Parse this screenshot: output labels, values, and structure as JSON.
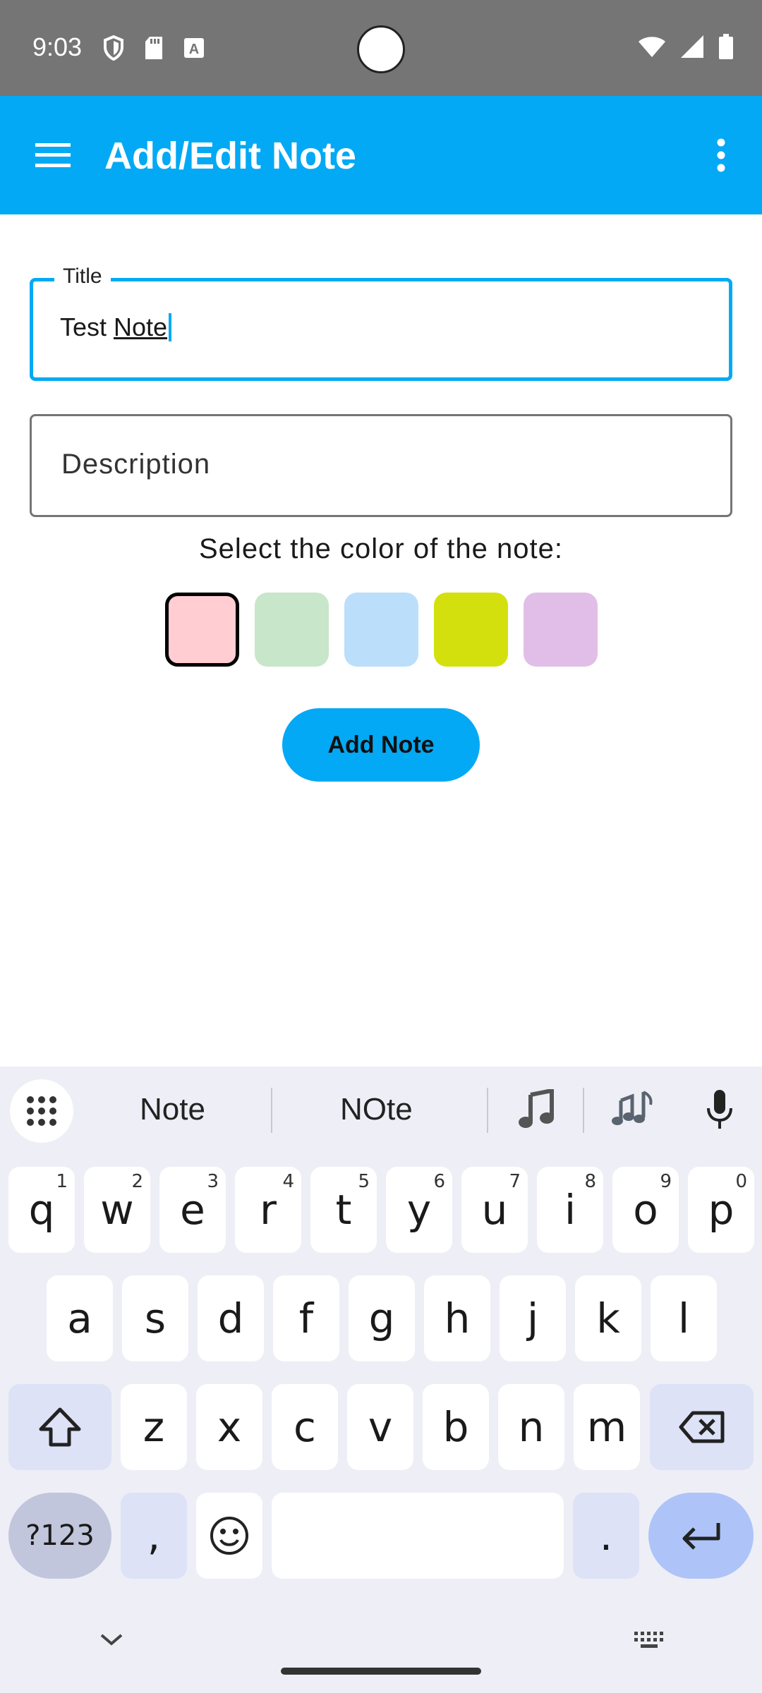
{
  "status_bar": {
    "time": "9:03",
    "icons_left": [
      "shield-icon",
      "sd-card-icon",
      "font-a-icon"
    ],
    "icons_right": [
      "wifi-icon",
      "signal-icon",
      "battery-icon"
    ]
  },
  "app_bar": {
    "title": "Add/Edit Note",
    "background": "#03a9f4",
    "menu_icon": "hamburger-menu-icon",
    "overflow_icon": "more-vert-icon"
  },
  "form": {
    "title_field": {
      "label": "Title",
      "value_plain": "Test ",
      "value_composing": "Note"
    },
    "description_field": {
      "placeholder": "Description"
    },
    "color_prompt": "Select the color of the note:",
    "colors": [
      {
        "name": "pink",
        "hex": "#ffcdd2",
        "selected": true
      },
      {
        "name": "green",
        "hex": "#c8e6c9",
        "selected": false
      },
      {
        "name": "blue",
        "hex": "#bbdefb",
        "selected": false
      },
      {
        "name": "lime",
        "hex": "#d4e00e",
        "selected": false
      },
      {
        "name": "purple",
        "hex": "#e1bee7",
        "selected": false
      }
    ],
    "submit_label": "Add Note"
  },
  "keyboard": {
    "suggestions": [
      "Note",
      "NOte"
    ],
    "emoji_suggestions": [
      "musical-note-emoji",
      "musical-notes-emoji"
    ],
    "row1": [
      {
        "k": "q",
        "h": "1"
      },
      {
        "k": "w",
        "h": "2"
      },
      {
        "k": "e",
        "h": "3"
      },
      {
        "k": "r",
        "h": "4"
      },
      {
        "k": "t",
        "h": "5"
      },
      {
        "k": "y",
        "h": "6"
      },
      {
        "k": "u",
        "h": "7"
      },
      {
        "k": "i",
        "h": "8"
      },
      {
        "k": "o",
        "h": "9"
      },
      {
        "k": "p",
        "h": "0"
      }
    ],
    "row2": [
      "a",
      "s",
      "d",
      "f",
      "g",
      "h",
      "j",
      "k",
      "l"
    ],
    "row3": [
      "z",
      "x",
      "c",
      "v",
      "b",
      "n",
      "m"
    ],
    "symbols_label": "?123",
    "comma": ",",
    "period": "."
  }
}
